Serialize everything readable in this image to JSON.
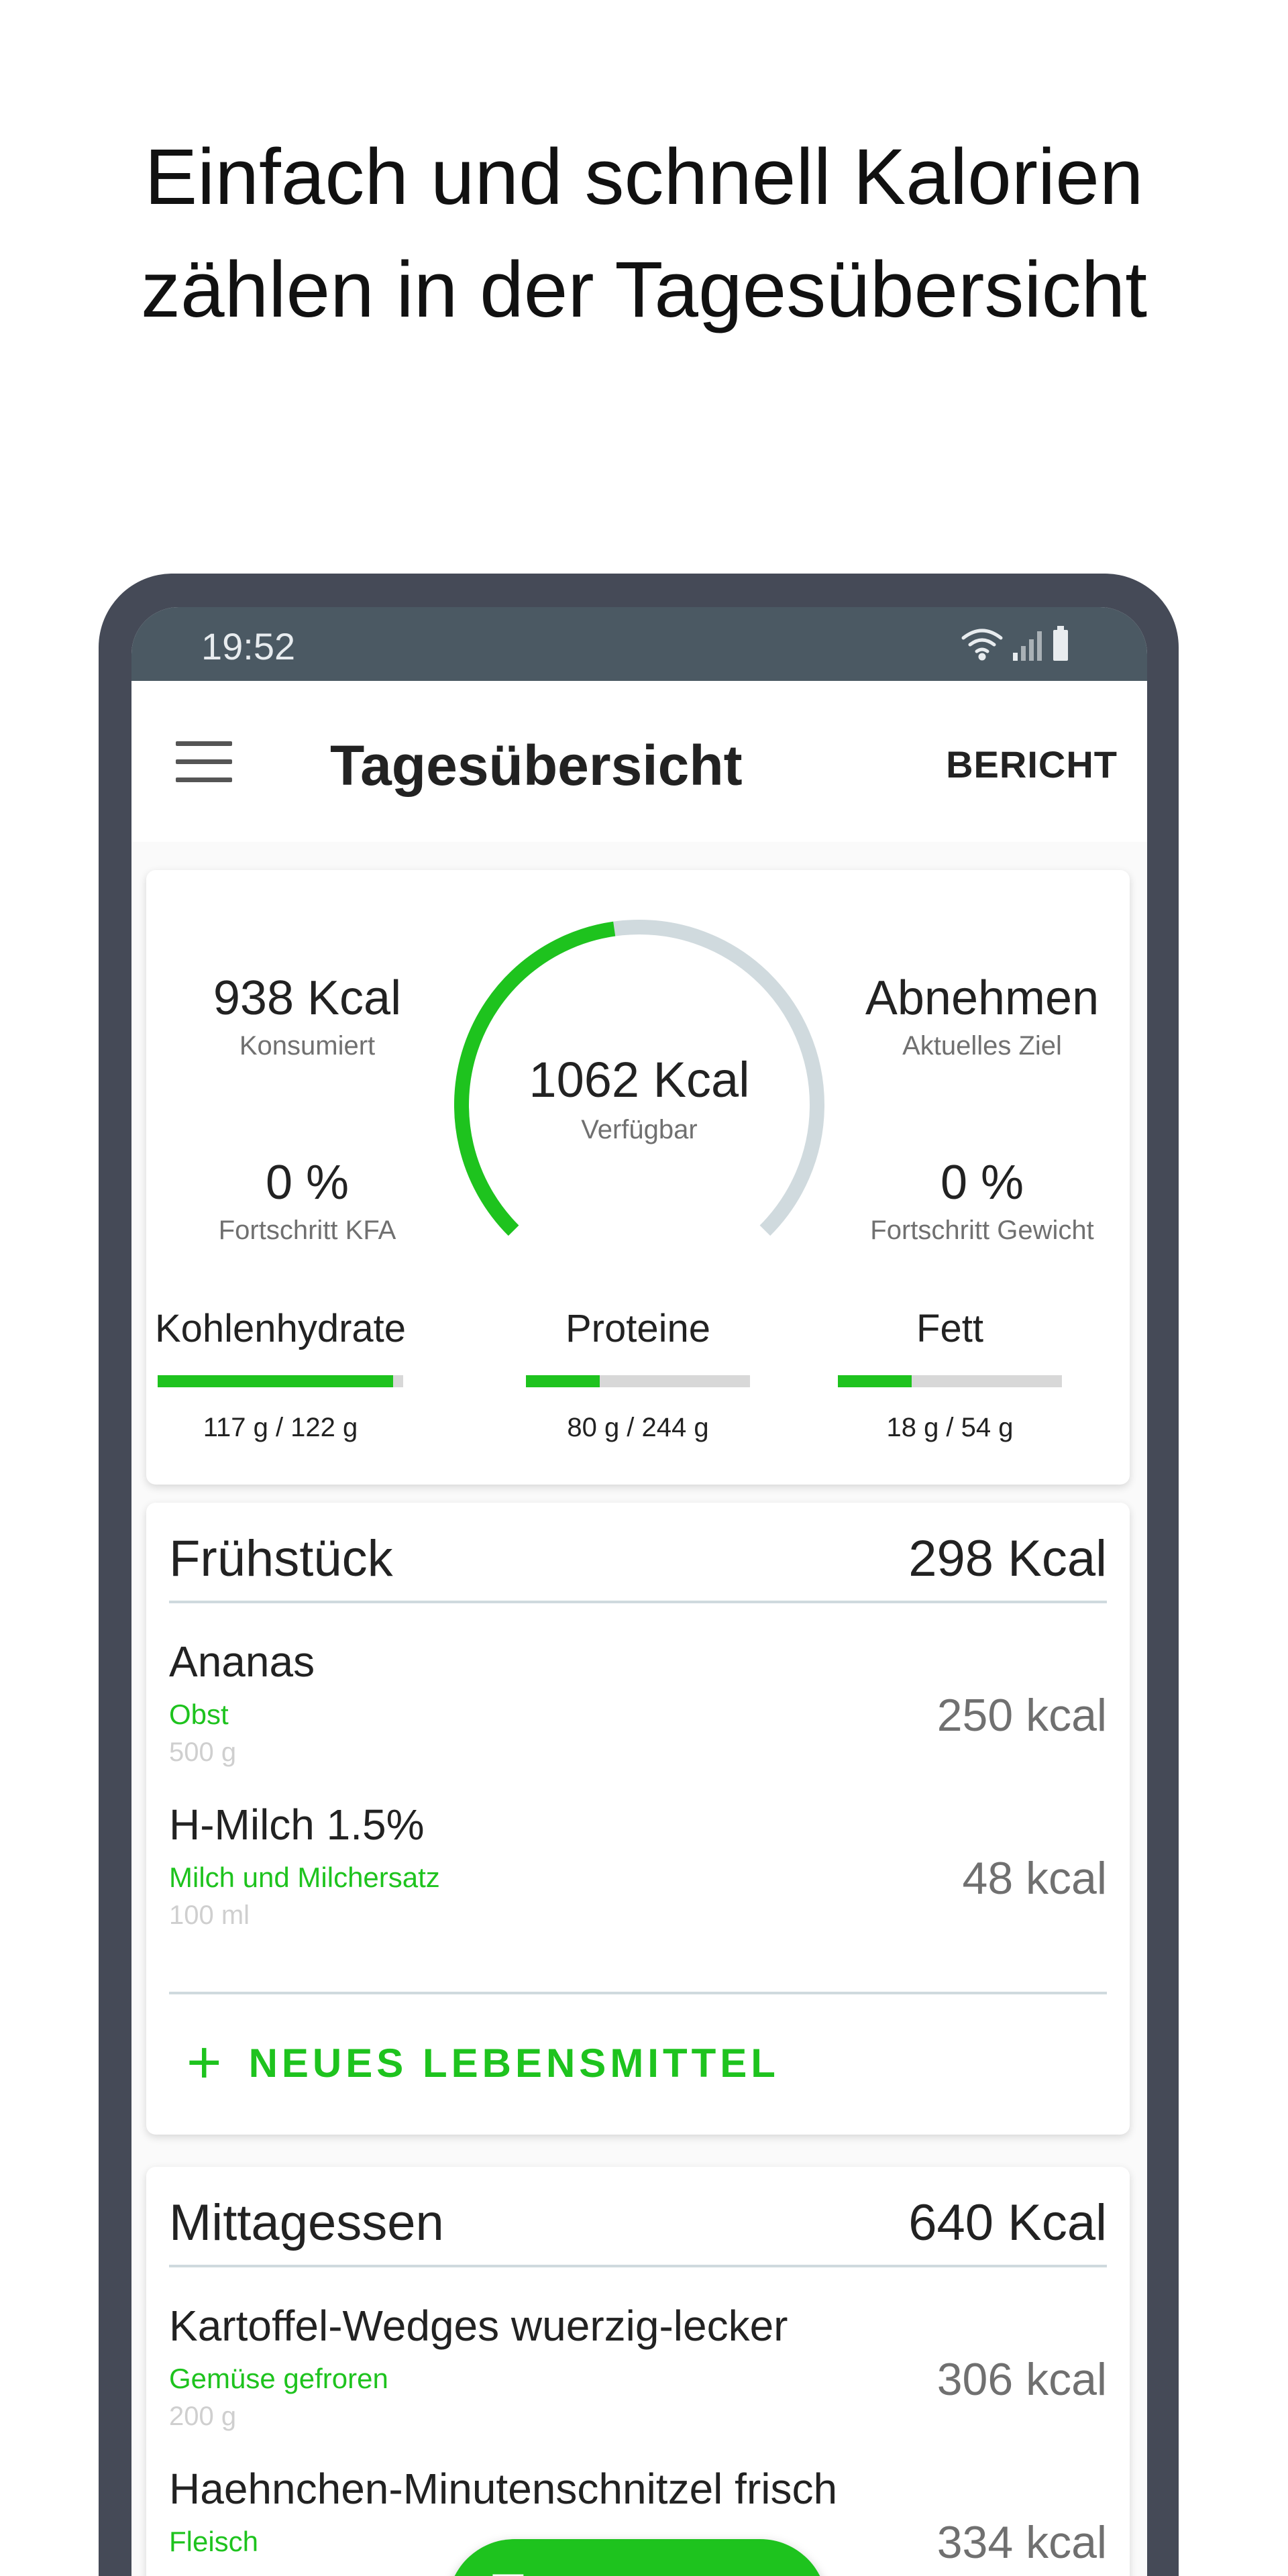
{
  "promo": {
    "line1": "Einfach und schnell Kalorien",
    "line2": "zählen in der Tagesübersicht"
  },
  "status_bar": {
    "time": "19:52",
    "icons": [
      "wifi-icon",
      "signal-icon",
      "battery-icon"
    ]
  },
  "app_bar": {
    "title": "Tagesübersicht",
    "action": "BERICHT",
    "menu_icon": "menu-icon"
  },
  "summary": {
    "consumed": {
      "value": "938 Kcal",
      "label": "Konsumiert"
    },
    "goal": {
      "value": "Abnehmen",
      "label": "Aktuelles Ziel"
    },
    "kfa": {
      "value": "0 %",
      "label": "Fortschritt KFA"
    },
    "weight": {
      "value": "0 %",
      "label": "Fortschritt Gewicht"
    },
    "available": {
      "value": "1062 Kcal",
      "label": "Verfügbar",
      "progress": 0.47
    },
    "macros": [
      {
        "name": "Kohlenhydrate",
        "amount": "117 g / 122 g",
        "progress": 0.96
      },
      {
        "name": "Proteine",
        "amount": "80 g / 244 g",
        "progress": 0.33
      },
      {
        "name": "Fett",
        "amount": "18 g / 54 g",
        "progress": 0.33
      }
    ]
  },
  "meals": [
    {
      "name": "Frühstück",
      "kcal": "298 Kcal",
      "items": [
        {
          "name": "Ananas",
          "category": "Obst",
          "amount": "500 g",
          "kcal": "250 kcal"
        },
        {
          "name": "H-Milch 1.5%",
          "category": "Milch und Milchersatz",
          "amount": "100 ml",
          "kcal": "48 kcal"
        }
      ],
      "add_label": "NEUES LEBENSMITTEL"
    },
    {
      "name": "Mittagessen",
      "kcal": "640 Kcal",
      "items": [
        {
          "name": "Kartoffel-Wedges wuerzig-lecker",
          "category": "Gemüse gefroren",
          "amount": "200 g",
          "kcal": "306 kcal"
        },
        {
          "name": "Haehnchen-Minutenschnitzel frisch",
          "category": "Fleisch",
          "amount": "",
          "kcal": "334 kcal"
        }
      ]
    }
  ],
  "colors": {
    "accent": "#1ec31e",
    "frame": "#454a57",
    "status_bar": "#4b5963",
    "track": "#d0dade"
  },
  "fab": {
    "icon": "calendar-icon"
  }
}
